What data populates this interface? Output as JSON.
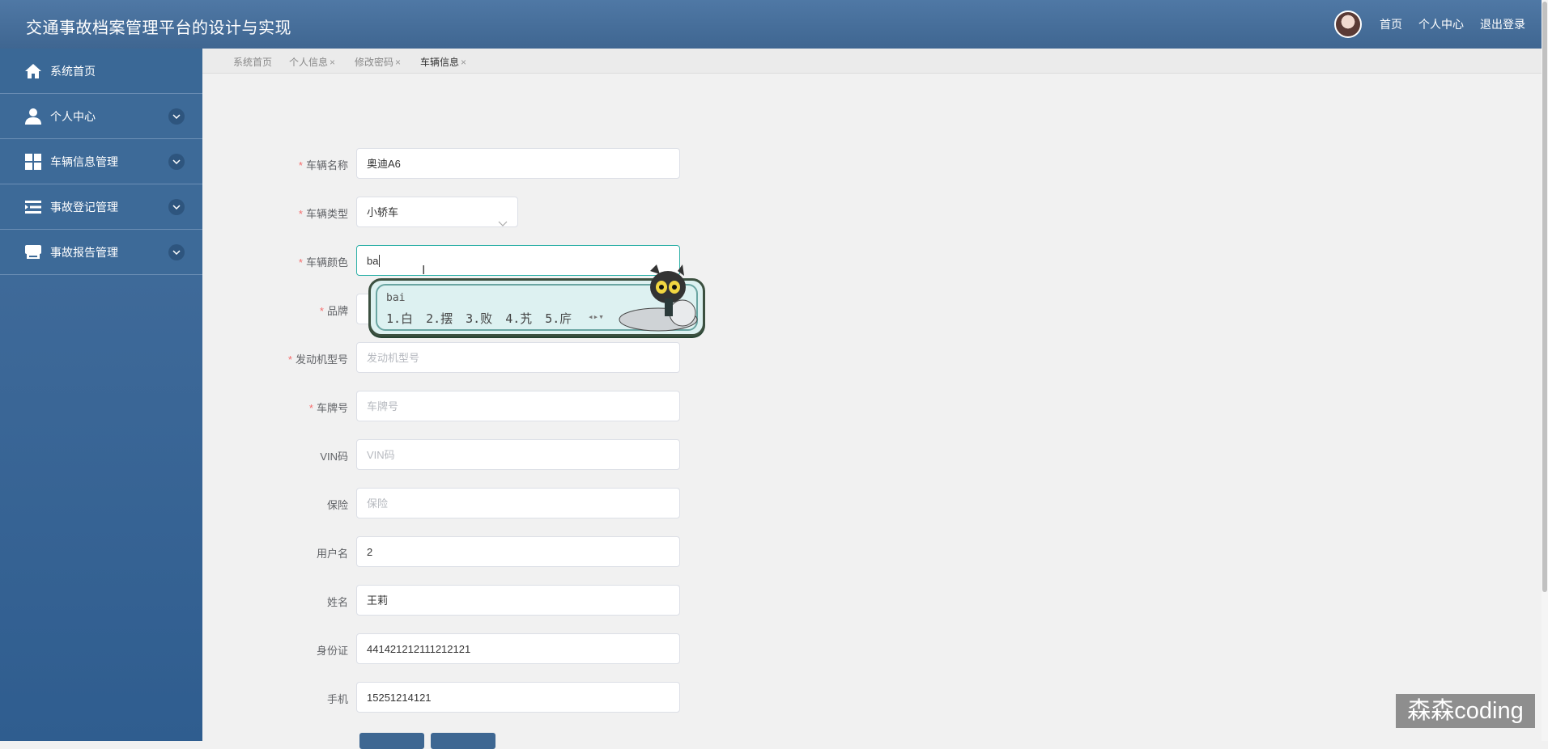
{
  "header": {
    "title": "交通事故档案管理平台的设计与实现",
    "links": [
      "首页",
      "个人中心",
      "退出登录"
    ]
  },
  "sidebar": {
    "items": [
      {
        "label": "系统首页",
        "icon": "home-icon",
        "expandable": false
      },
      {
        "label": "个人中心",
        "icon": "user-icon",
        "expandable": true
      },
      {
        "label": "车辆信息管理",
        "icon": "grid-icon",
        "expandable": true
      },
      {
        "label": "事故登记管理",
        "icon": "list-icon",
        "expandable": true
      },
      {
        "label": "事故报告管理",
        "icon": "store-icon",
        "expandable": true
      }
    ]
  },
  "tabs": [
    {
      "label": "系统首页",
      "closable": false,
      "active": false
    },
    {
      "label": "个人信息",
      "closable": true,
      "active": false
    },
    {
      "label": "修改密码",
      "closable": true,
      "active": false
    },
    {
      "label": "车辆信息",
      "closable": true,
      "active": true
    }
  ],
  "close_mark": "×",
  "form": {
    "fields": [
      {
        "label": "车辆名称",
        "required": true,
        "value": "奥迪A6",
        "placeholder": ""
      },
      {
        "label": "车辆类型",
        "required": true,
        "value": "小轿车",
        "placeholder": ""
      },
      {
        "label": "车辆颜色",
        "required": true,
        "value": "ba",
        "placeholder": ""
      },
      {
        "label": "品牌",
        "required": true,
        "value": "",
        "placeholder": ""
      },
      {
        "label": "发动机型号",
        "required": true,
        "value": "",
        "placeholder": "发动机型号"
      },
      {
        "label": "车牌号",
        "required": true,
        "value": "",
        "placeholder": "车牌号"
      },
      {
        "label": "VIN码",
        "required": false,
        "value": "",
        "placeholder": "VIN码"
      },
      {
        "label": "保险",
        "required": false,
        "value": "",
        "placeholder": "保险"
      },
      {
        "label": "用户名",
        "required": false,
        "value": "2",
        "placeholder": ""
      },
      {
        "label": "姓名",
        "required": false,
        "value": "王莉",
        "placeholder": ""
      },
      {
        "label": "身份证",
        "required": false,
        "value": "441421212111212121",
        "placeholder": ""
      },
      {
        "label": "手机",
        "required": false,
        "value": "15251214121",
        "placeholder": ""
      }
    ]
  },
  "ime": {
    "typed": "bai",
    "candidates": [
      "1.白",
      "2.摆",
      "3.败",
      "4.艽",
      "5.庍"
    ]
  },
  "watermark": "森森coding",
  "colors": {
    "header": "#46709e",
    "sidebar": "#3d6a98",
    "focus_border": "#2fb1a8",
    "required": "#f56c6c"
  }
}
